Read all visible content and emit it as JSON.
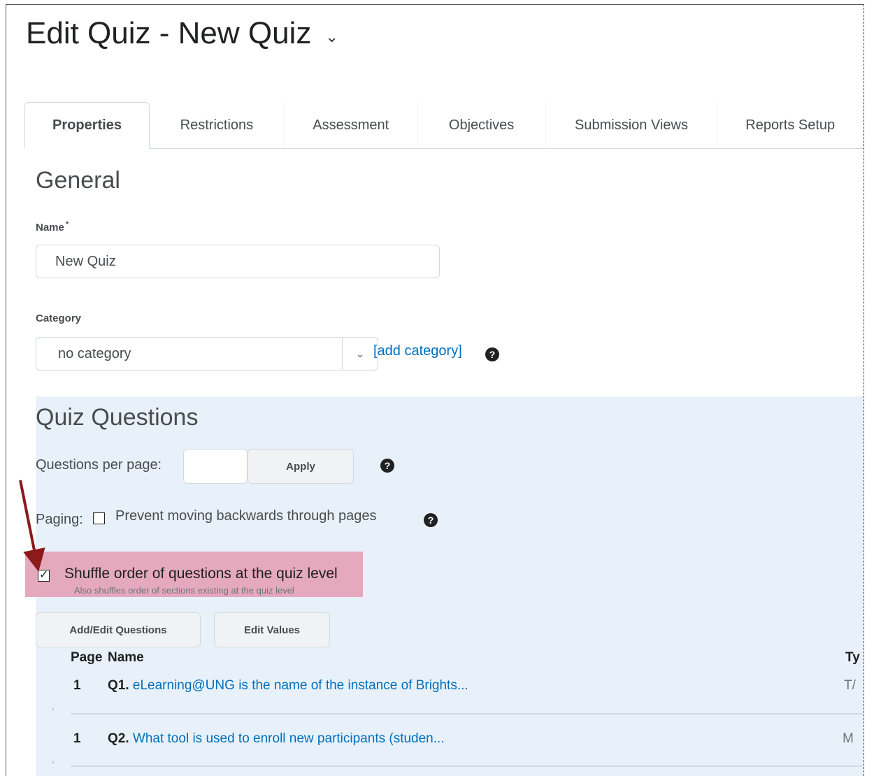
{
  "page": {
    "title": "Edit Quiz - New Quiz",
    "title_menu_icon": "chevron-down-icon"
  },
  "tabs": [
    {
      "label": "Properties",
      "active": true
    },
    {
      "label": "Restrictions"
    },
    {
      "label": "Assessment"
    },
    {
      "label": "Objectives"
    },
    {
      "label": "Submission Views"
    },
    {
      "label": "Reports Setup"
    }
  ],
  "general": {
    "heading": "General",
    "name_label": "Name",
    "name_required": "*",
    "name_value": "New Quiz",
    "category_label": "Category",
    "category_value": "no category",
    "add_category": "[add category]",
    "help_icon": "question-circle-icon"
  },
  "quiz_questions": {
    "heading": "Quiz Questions",
    "questions_per_page_label": "Questions per page:",
    "questions_per_page_value": "",
    "apply_button": "Apply",
    "paging_label": "Paging:",
    "prevent_backwards_label": "Prevent moving backwards through pages",
    "prevent_backwards_checked": false,
    "shuffle_label": "Shuffle order of questions at the quiz level",
    "shuffle_sub": "Also shuffles order of sections existing at the quiz level",
    "shuffle_checked": true,
    "add_edit_button": "Add/Edit Questions",
    "edit_values_button": "Edit Values",
    "columns": {
      "page": "Page",
      "name": "Name",
      "type": "Ty"
    },
    "rows": [
      {
        "page": "1",
        "number": "Q1.",
        "text": "eLearning@UNG is the name of the instance of Brights...",
        "type": "T/"
      },
      {
        "page": "1",
        "number": "Q2.",
        "text": "What tool is used to enroll new participants (studen...",
        "type": "M"
      }
    ],
    "row_marker": "›"
  },
  "colors": {
    "link": "#006fbf",
    "highlight": "#e5a9bd",
    "quiz_bg": "#e8f1f9",
    "annotation_arrow": "#8b1a1a"
  }
}
